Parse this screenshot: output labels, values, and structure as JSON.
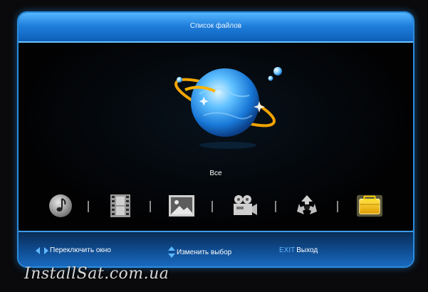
{
  "header": {
    "title": "Список файлов"
  },
  "selection": {
    "label": "Все"
  },
  "categories": [
    {
      "icon": "music-icon",
      "selected": false
    },
    {
      "icon": "film-icon",
      "selected": false
    },
    {
      "icon": "image-icon",
      "selected": false
    },
    {
      "icon": "video-camera-icon",
      "selected": false
    },
    {
      "icon": "recycle-icon",
      "selected": false
    },
    {
      "icon": "folder-all-icon",
      "selected": true
    }
  ],
  "footer": {
    "switch_window": "Переключить окно",
    "change_selection": "Изменить выбор",
    "exit_key": "EXIT",
    "exit_label": "Выход"
  },
  "watermark": "InstallSat.com.ua",
  "colors": {
    "accent": "#2a8bdc",
    "selected_icon": "#f2c200",
    "header": "#1f7fdc"
  }
}
